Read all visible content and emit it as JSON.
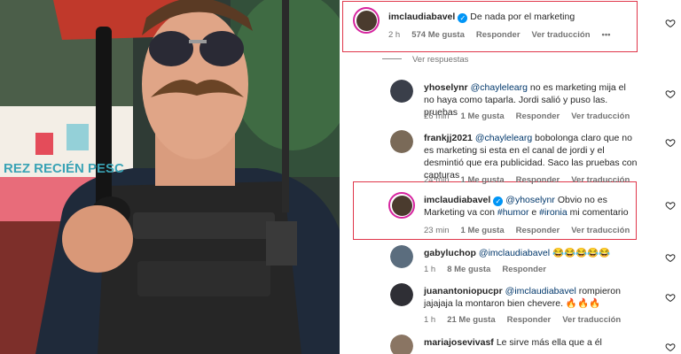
{
  "photo": {
    "sign_text": "REZ RECIÉN PESC"
  },
  "comments": [
    {
      "username": "imclaudiabavel",
      "verified": true,
      "segments": [
        {
          "t": "De nada por el marketing",
          "m": false
        }
      ],
      "time": "2 h",
      "likes": "574 Me gusta",
      "reply": "Responder",
      "translate": "Ver traducción",
      "more": "•••",
      "avatar_color": "#4a3b2e"
    },
    {
      "username": "yhoselynr",
      "verified": false,
      "segments": [
        {
          "t": "@chaylelearg",
          "m": true
        },
        {
          "t": " no es marketing mija el no haya como taparla. Jordi salió y puso las. pruebas",
          "m": false
        }
      ],
      "time": "26 min",
      "likes": "1 Me gusta",
      "reply": "Responder",
      "translate": "Ver traducción",
      "avatar_color": "#3a3f4a"
    },
    {
      "username": "frankjj2021",
      "verified": false,
      "segments": [
        {
          "t": "@chaylelearg",
          "m": true
        },
        {
          "t": " bobolonga claro que no es marketing si esta en el canal de jordi y el desmintió que era publicidad. Saco las pruebas con capturas",
          "m": false
        }
      ],
      "time": "24 min",
      "likes": "1 Me gusta",
      "reply": "Responder",
      "translate": "Ver traducción",
      "avatar_color": "#7a6a58"
    },
    {
      "username": "imclaudiabavel",
      "verified": true,
      "segments": [
        {
          "t": "@yhoselynr",
          "m": true
        },
        {
          "t": " Obvio no es Marketing va con ",
          "m": false
        },
        {
          "t": "#humor",
          "m": true
        },
        {
          "t": " e ",
          "m": false
        },
        {
          "t": "#ironia",
          "m": true
        },
        {
          "t": " mi comentario",
          "m": false
        }
      ],
      "time": "23 min",
      "likes": "1 Me gusta",
      "reply": "Responder",
      "translate": "Ver traducción",
      "avatar_color": "#4a3b2e"
    },
    {
      "username": "gabyluchop",
      "verified": false,
      "segments": [
        {
          "t": "@imclaudiabavel",
          "m": true
        },
        {
          "t": " 😂😂😂😂😂",
          "m": false
        }
      ],
      "time": "1 h",
      "likes": "8 Me gusta",
      "reply": "Responder",
      "translate": "",
      "avatar_color": "#5b6d7e"
    },
    {
      "username": "juanantoniopucpr",
      "verified": false,
      "segments": [
        {
          "t": "@imclaudiabavel",
          "m": true
        },
        {
          "t": " rompieron jajajaja la montaron bien chevere. 🔥🔥🔥",
          "m": false
        }
      ],
      "time": "1 h",
      "likes": "21 Me gusta",
      "reply": "Responder",
      "translate": "Ver traducción",
      "avatar_color": "#2f2f35"
    },
    {
      "username": "mariajosevivasf",
      "verified": false,
      "segments": [
        {
          "t": "Le sirve más ella que a él",
          "m": false
        }
      ],
      "time": "",
      "likes": "",
      "reply": "",
      "translate": "",
      "avatar_color": "#8a7563"
    }
  ],
  "view_replies": "Ver respuestas"
}
